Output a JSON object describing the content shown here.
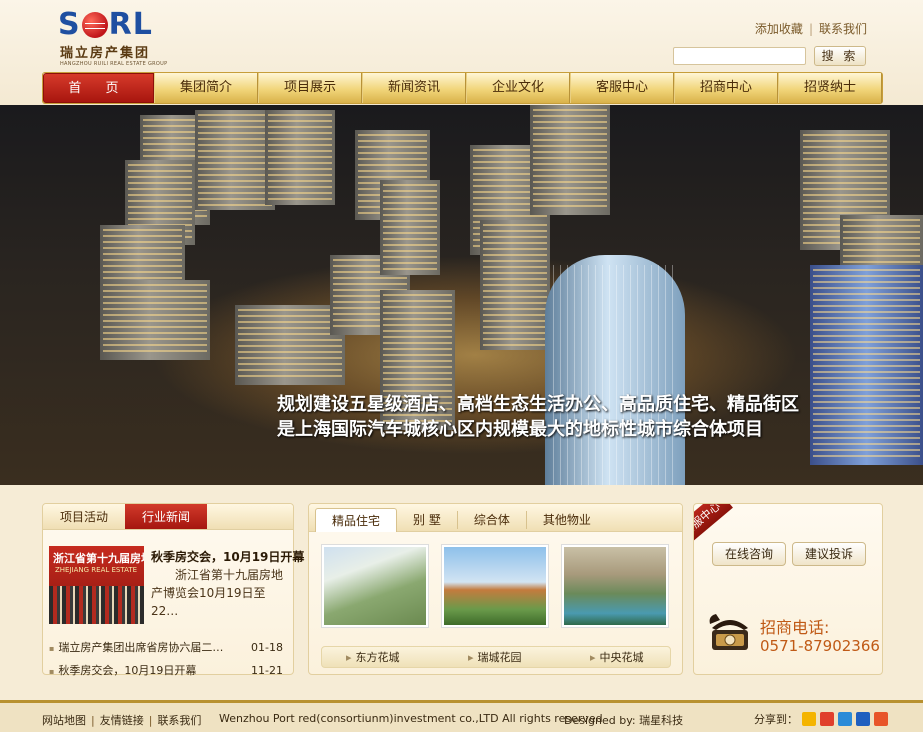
{
  "header": {
    "logo_mark_left": "S",
    "logo_mark_right": "RL",
    "logo_cn": "瑞立房产集团",
    "logo_en": "HANGZHOU RUILI REAL ESTATE GROUP",
    "top_links": [
      "添加收藏",
      "联系我们"
    ],
    "search_button": "搜 索",
    "search_placeholder": ""
  },
  "nav": {
    "items": [
      "首 页",
      "集团简介",
      "项目展示",
      "新闻资讯",
      "企业文化",
      "客服中心",
      "招商中心",
      "招贤纳士"
    ],
    "active_index": 0
  },
  "banner": {
    "caption_line1": "规划建设五星级酒店、高档生态生活办公、高品质住宅、精品街区",
    "caption_line2": "是上海国际汽车城核心区内规模最大的地标性城市综合体项目"
  },
  "news": {
    "tabs": [
      "项目活动",
      "行业新闻"
    ],
    "image_sign": "浙江省第十九届房地",
    "image_sign_en": "ZHEJIANG REAL ESTATE",
    "headline": "秋季房交会，10月19日开幕",
    "summary": "浙江省第十九届房地产博览会10月19日至22…",
    "items": [
      {
        "title": "瑞立房产集团出席省房协六届二…",
        "date": "01-18"
      },
      {
        "title": "秋季房交会，10月19日开幕",
        "date": "11-21"
      }
    ]
  },
  "products": {
    "tabs": [
      "精品住宅",
      "别 墅",
      "综合体",
      "其他物业"
    ],
    "active_index": 0,
    "items": [
      {
        "name": "东方花城"
      },
      {
        "name": "瑞城花园"
      },
      {
        "name": "中央花城"
      }
    ]
  },
  "service": {
    "ribbon": "客服中心",
    "buttons": [
      "在线咨询",
      "建议投诉"
    ],
    "phone_label": "招商电话:",
    "phone_number": "0571-87902366"
  },
  "footer": {
    "links": [
      "网站地图",
      "友情链接",
      "联系我们"
    ],
    "copyright": "Wenzhou Port red(consortiunm)investment co.,LTD All rights reserved",
    "designed_by": "Designed by: 瑞星科技",
    "share_label": "分享到：",
    "share_icons": [
      "qzone-icon",
      "sina-weibo-icon",
      "tencent-weibo-icon",
      "baidu-icon",
      "favorites-icon"
    ],
    "share_colors": [
      "#f4b400",
      "#e0402c",
      "#2a8bd8",
      "#1f5fbf",
      "#e8552a"
    ]
  }
}
